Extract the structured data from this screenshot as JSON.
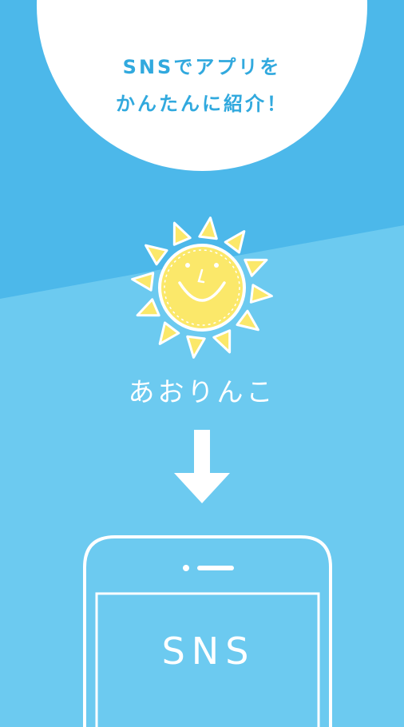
{
  "header": {
    "tagline_line1": "SNSでアプリを",
    "tagline_line2": "かんたんに紹介！"
  },
  "app": {
    "name": "あおりんこ",
    "logo_icon": "smiling-sun-icon"
  },
  "flow": {
    "arrow_icon": "arrow-down-icon"
  },
  "phone": {
    "screen_text": "SNS"
  },
  "colors": {
    "background_top": "#4cb8ea",
    "background_bottom": "#6ccaf0",
    "accent_text": "#31a9de",
    "sun_yellow": "#fbe86a",
    "white": "#ffffff"
  }
}
